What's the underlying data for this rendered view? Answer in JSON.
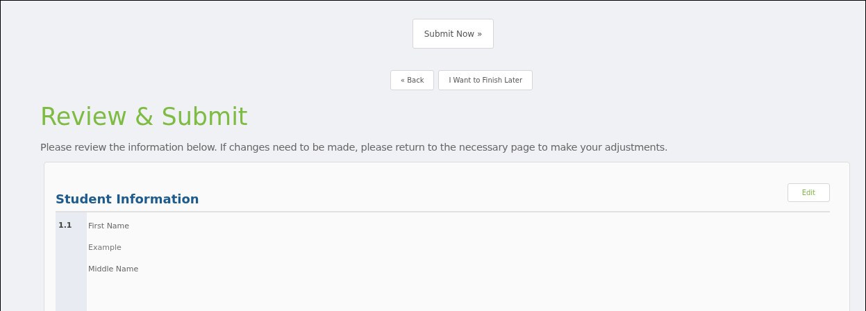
{
  "submit_button": "Submit Now »",
  "nav_buttons": [
    "« Back",
    "I Want to Finish Later"
  ],
  "title": "Review & Submit",
  "intro": "Please review the information below. If changes need to be made, please return to the necessary page to make your adjustments.",
  "section": {
    "title": "Student Information",
    "edit_button": "Edit",
    "questions": [
      {
        "number": "1.1",
        "lines": [
          {
            "kind": "label",
            "text": "First Name"
          },
          {
            "kind": "answer",
            "text": "Example"
          },
          {
            "kind": "label",
            "text": "Middle Name"
          }
        ]
      }
    ]
  }
}
